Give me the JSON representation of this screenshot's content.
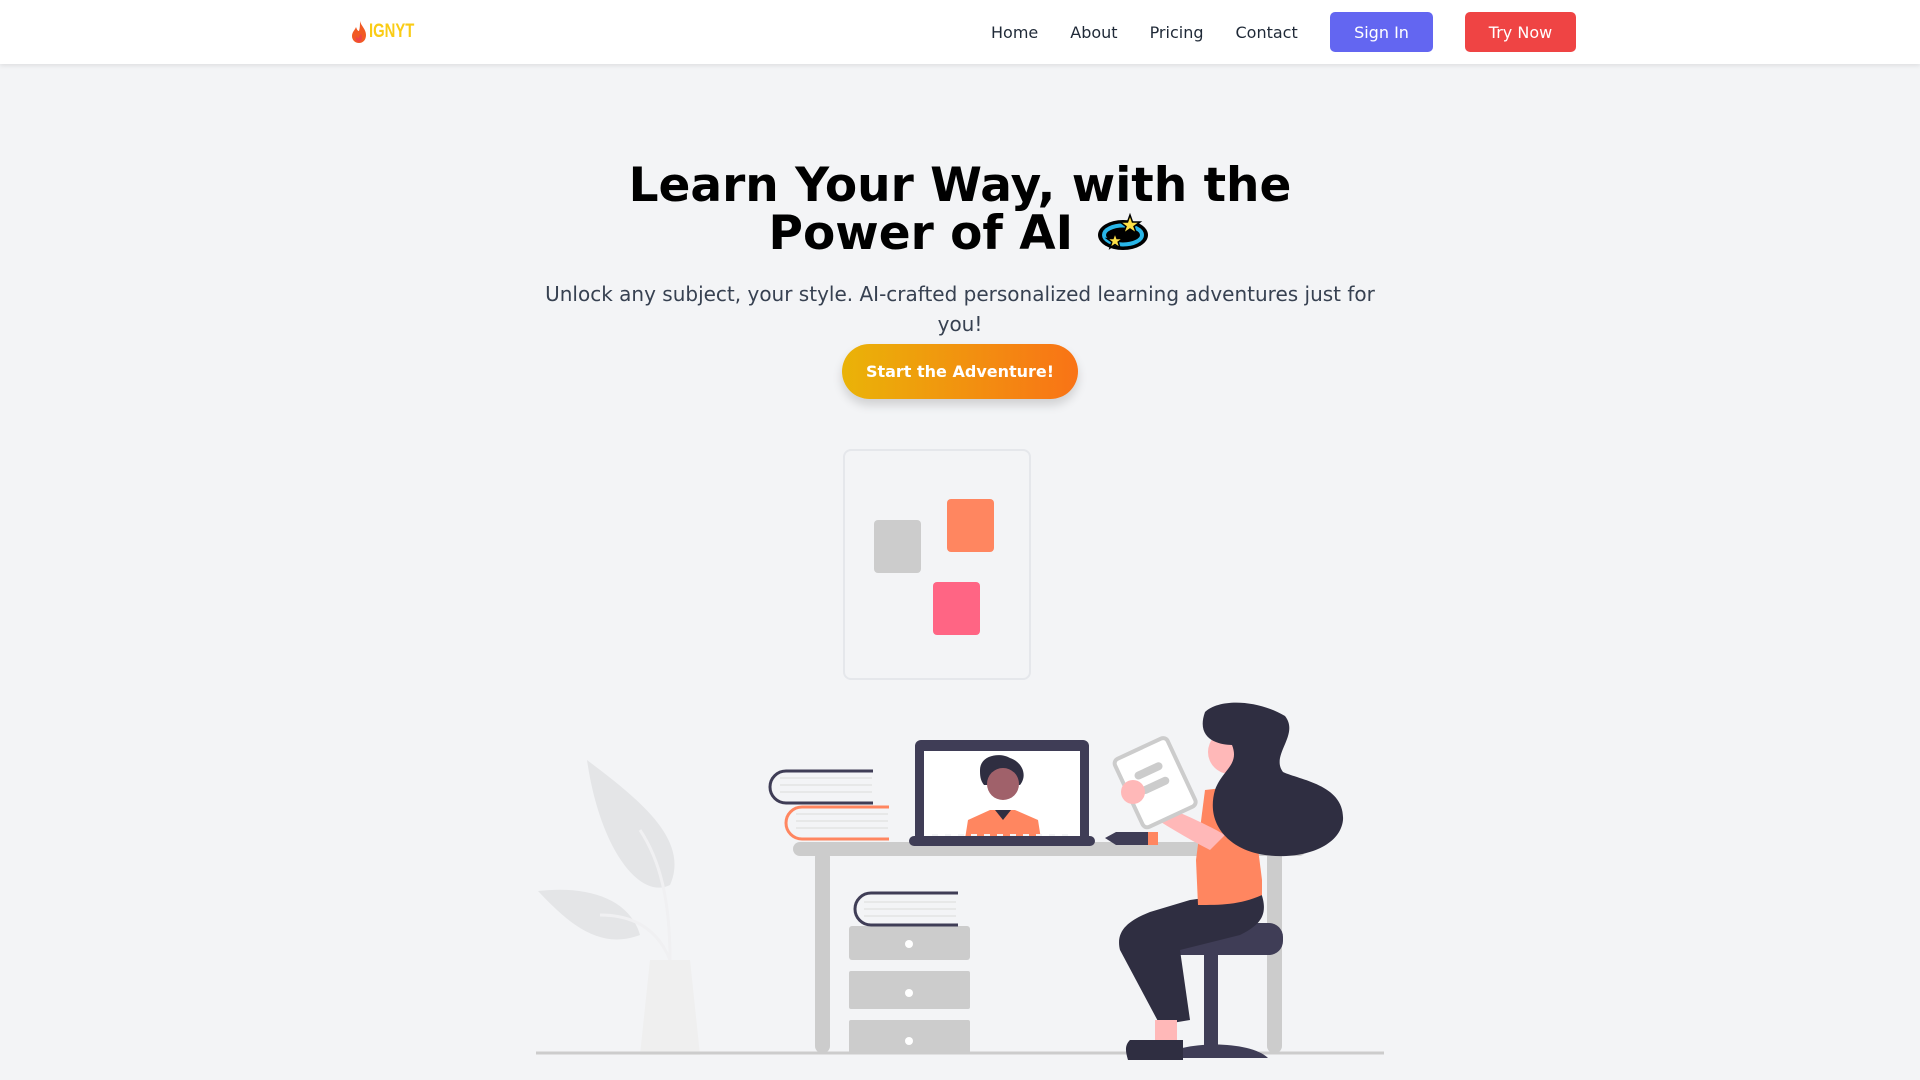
{
  "navbar": {
    "logo_text": "IGNYT",
    "links": [
      {
        "label": "Home"
      },
      {
        "label": "About"
      },
      {
        "label": "Pricing"
      },
      {
        "label": "Contact"
      }
    ],
    "signin_label": "Sign In",
    "try_label": "Try Now"
  },
  "hero": {
    "title_line1": "Learn Your Way, with the",
    "title_line2": "Power of AI",
    "title_emoji": "dizzy-orbit-stars",
    "subtitle": "Unlock any subject, your style. AI-crafted personalized learning adventures just for you!",
    "cta_label": "Start the Adventure!"
  },
  "colors": {
    "signin": "#6366f1",
    "try_now": "#ef4444",
    "cta_from": "#eab308",
    "cta_to": "#f97316",
    "accent_orange": "#ff8660",
    "accent_pink": "#ff6584",
    "dark": "#2f2e41"
  }
}
